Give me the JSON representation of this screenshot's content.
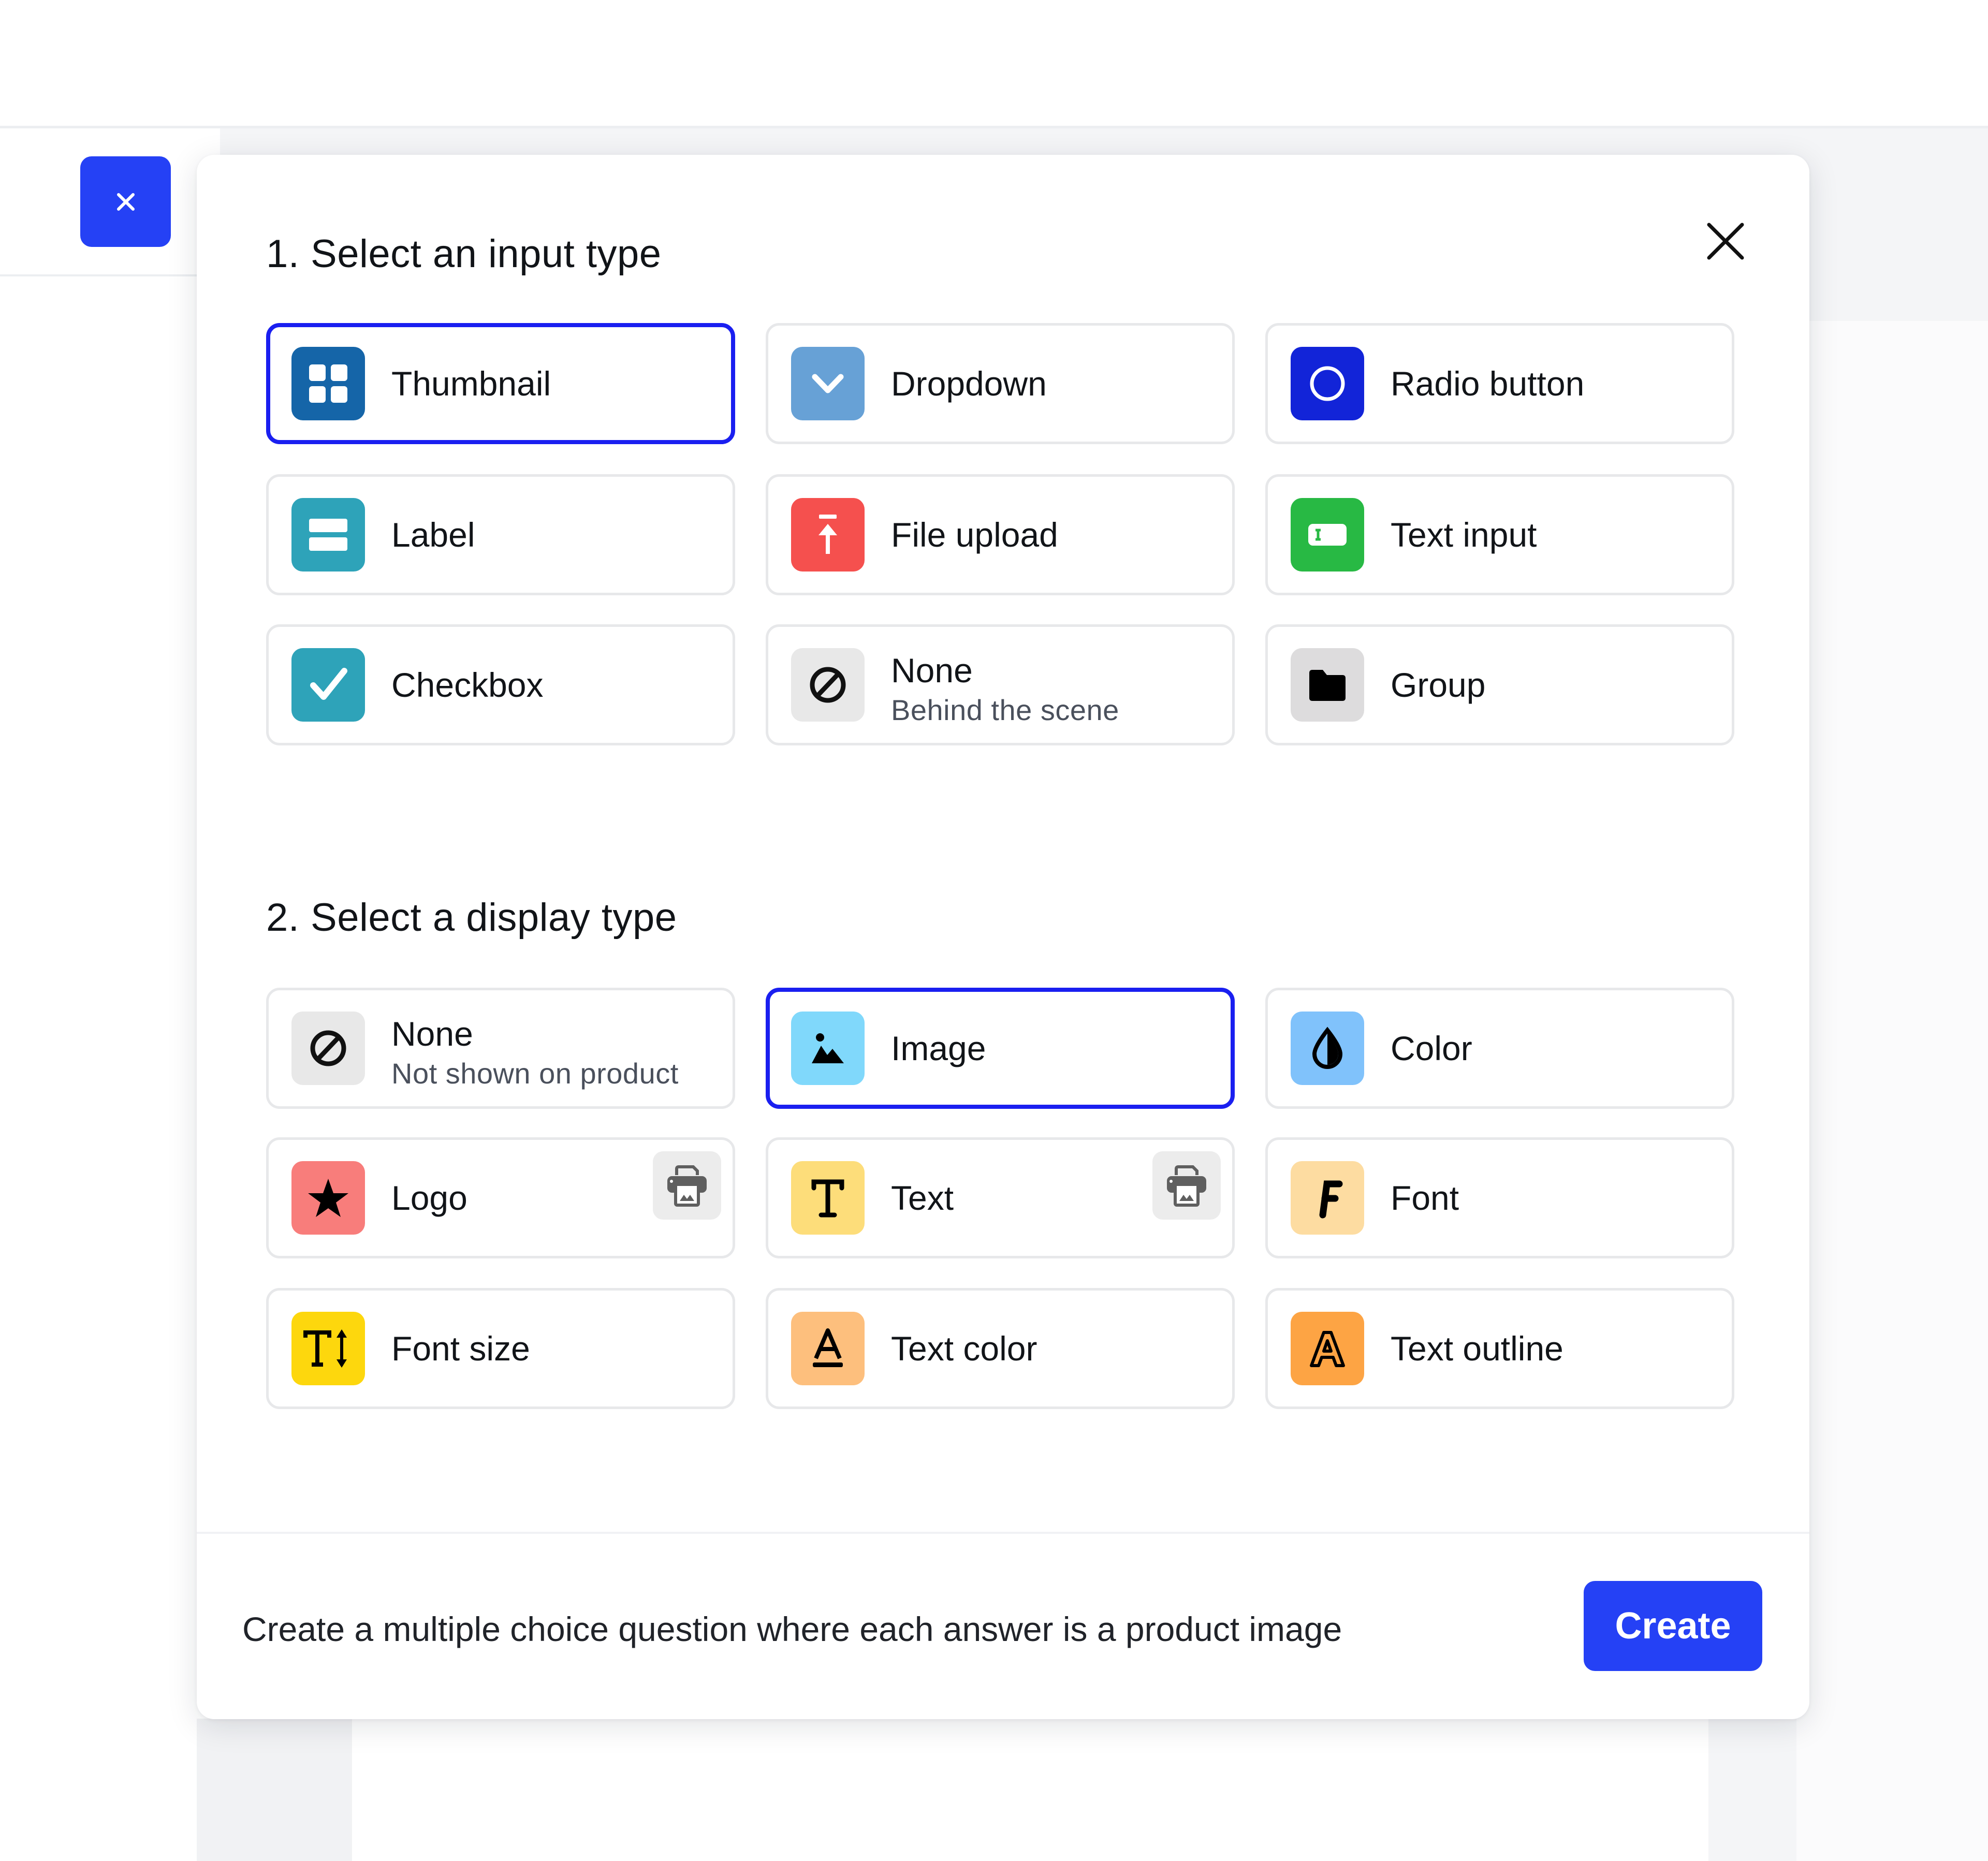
{
  "colors": {
    "accent": "#2541f5",
    "selected_border": "#1a1ff0"
  },
  "side_button": {
    "icon": "close-icon",
    "label": "×"
  },
  "modal": {
    "close_icon": "close-icon",
    "input_section_title": "1. Select an input type",
    "display_section_title": "2. Select a display type",
    "input_types": [
      {
        "label": "Thumbnail",
        "icon": "grid-icon",
        "color": "#1565a8",
        "selected": true
      },
      {
        "label": "Dropdown",
        "icon": "chevron-down-icon",
        "color": "#67a1d6",
        "selected": false
      },
      {
        "label": "Radio button",
        "icon": "radio-icon",
        "color": "#1224d8",
        "selected": false
      },
      {
        "label": "Label",
        "icon": "label-icon",
        "color": "#2ea3b9",
        "selected": false
      },
      {
        "label": "File upload",
        "icon": "upload-icon",
        "color": "#f5504e",
        "selected": false
      },
      {
        "label": "Text input",
        "icon": "text-input-icon",
        "color": "#28b944",
        "selected": false
      },
      {
        "label": "Checkbox",
        "icon": "checkmark-icon",
        "color": "#2ea3b9",
        "selected": false
      },
      {
        "label": "None",
        "sublabel": "Behind the scene",
        "icon": "none-icon",
        "color": "#e8e8e8",
        "selected": false
      },
      {
        "label": "Group",
        "icon": "folder-icon",
        "color": "#dddcdd",
        "selected": false
      }
    ],
    "display_types": [
      {
        "label": "None",
        "sublabel": "Not shown on product",
        "icon": "none-icon",
        "color": "#e8e8e8",
        "selected": false,
        "printable": false
      },
      {
        "label": "Image",
        "icon": "image-icon",
        "color": "#80d8fb",
        "selected": true,
        "printable": false
      },
      {
        "label": "Color",
        "icon": "drop-icon",
        "color": "#80c2fb",
        "selected": false,
        "printable": false
      },
      {
        "label": "Logo",
        "icon": "star-icon",
        "color": "#f87d7b",
        "selected": false,
        "printable": true
      },
      {
        "label": "Text",
        "icon": "text-t-icon",
        "color": "#fddd7a",
        "selected": false,
        "printable": true
      },
      {
        "label": "Font",
        "icon": "font-f-icon",
        "color": "#fddca1",
        "selected": false,
        "printable": false
      },
      {
        "label": "Font size",
        "icon": "font-size-icon",
        "color": "#fdd70d",
        "selected": false,
        "printable": false
      },
      {
        "label": "Text color",
        "icon": "text-color-icon",
        "color": "#fdbf7d",
        "selected": false,
        "printable": false
      },
      {
        "label": "Text outline",
        "icon": "text-outline-icon",
        "color": "#fda444",
        "selected": false,
        "printable": false
      }
    ],
    "footer": {
      "description": "Create a multiple choice question where each answer is a product image",
      "create_label": "Create"
    }
  }
}
